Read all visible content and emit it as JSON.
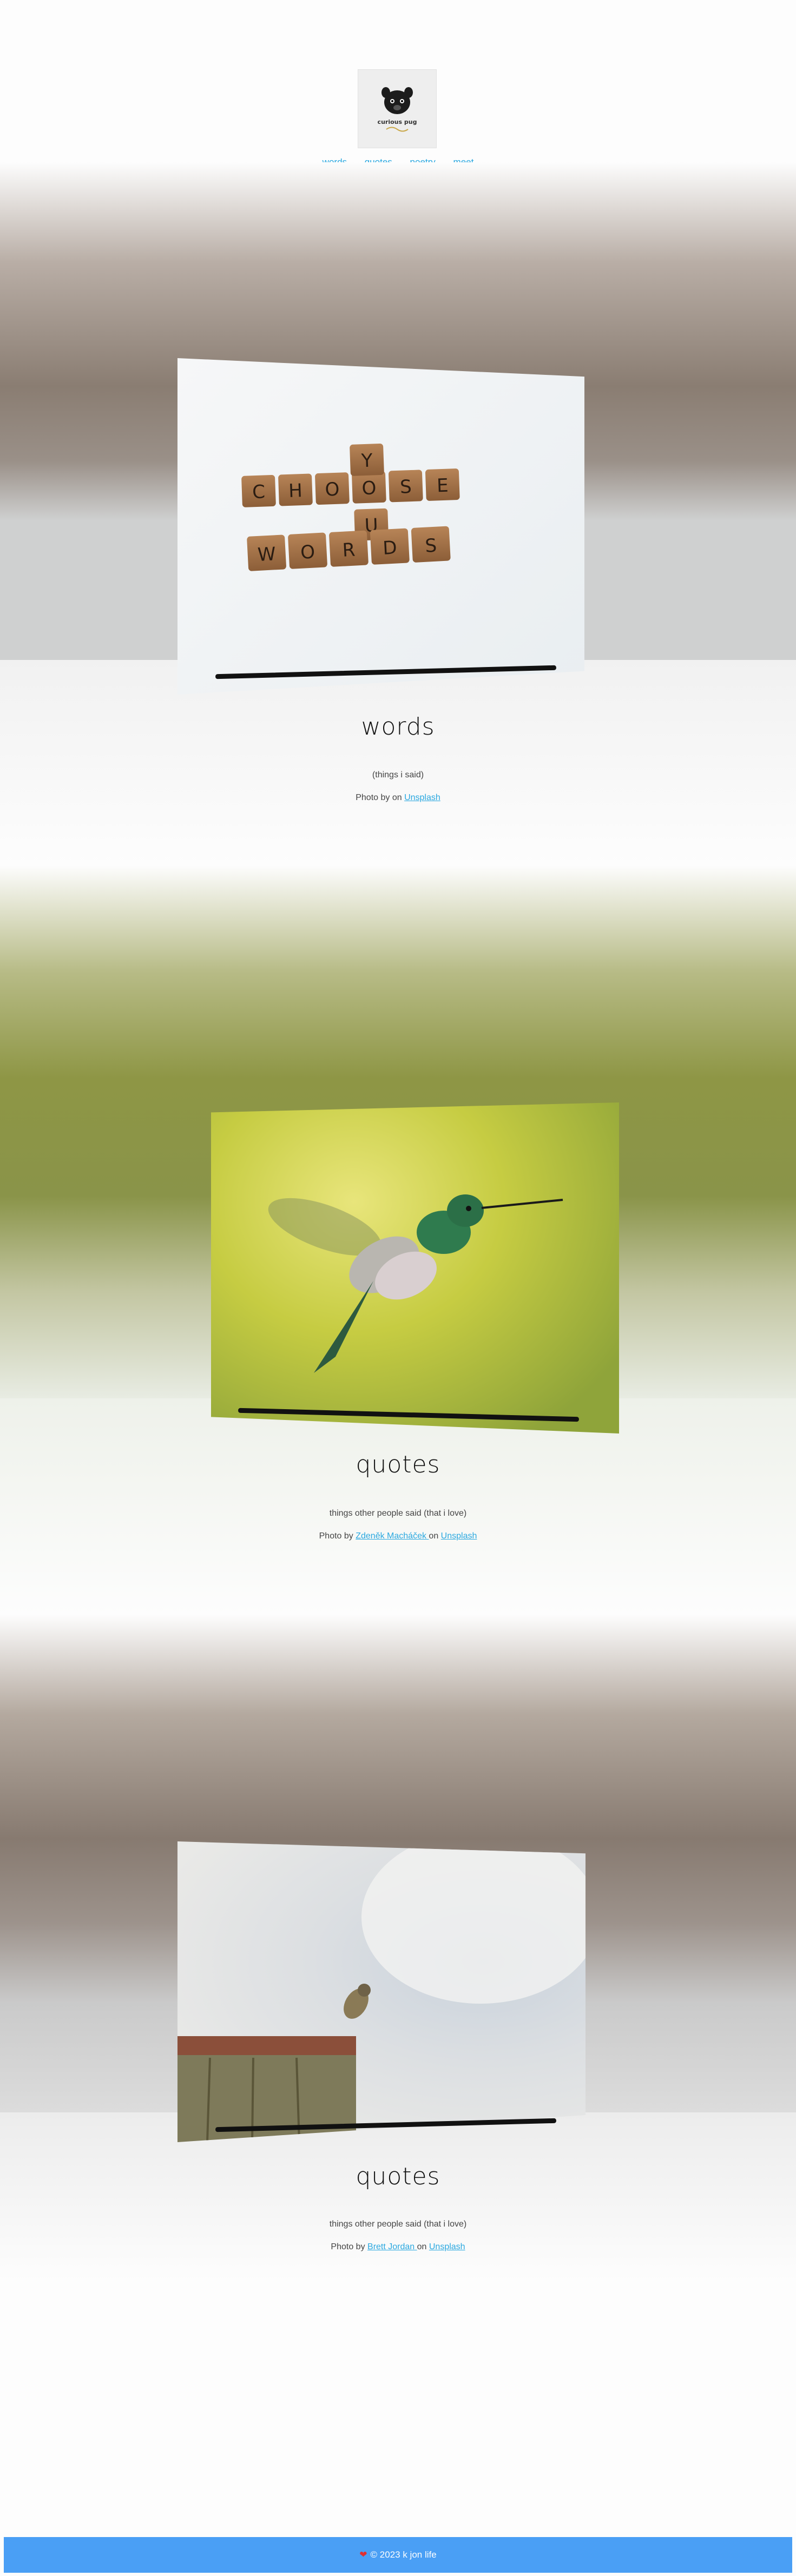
{
  "header": {
    "logo_text": "curious pug",
    "nav": [
      "words",
      "quotes",
      "poetry",
      "meet"
    ]
  },
  "sections": [
    {
      "title": "words",
      "subtitle": "(things i said)",
      "credit_prefix": "Photo by ",
      "photographer": "",
      "credit_mid": " on ",
      "source": "Unsplash",
      "tiles_row1": [
        "C",
        "H",
        "O",
        "O",
        "S",
        "E"
      ],
      "tiles_col": [
        "Y",
        "O",
        "U"
      ],
      "tiles_row2": [
        "W",
        "O",
        "R",
        "D",
        "S"
      ]
    },
    {
      "title": "quotes",
      "subtitle": "things other people said (that i love)",
      "credit_prefix": "Photo by ",
      "photographer": "Zdeněk Macháček ",
      "credit_mid": "on ",
      "source": "Unsplash"
    },
    {
      "title": "quotes",
      "subtitle": "things other people said (that i love)",
      "credit_prefix": "Photo by ",
      "photographer": "Brett Jordan ",
      "credit_mid": "on ",
      "source": "Unsplash"
    }
  ],
  "footer": {
    "text": "© 2023 k jon life"
  },
  "colors": {
    "link": "#2aa8e0",
    "footer_bg": "#4a9ff5",
    "band1": "#8a7d72",
    "band2": "#8e9645",
    "band3": "#877a70"
  }
}
